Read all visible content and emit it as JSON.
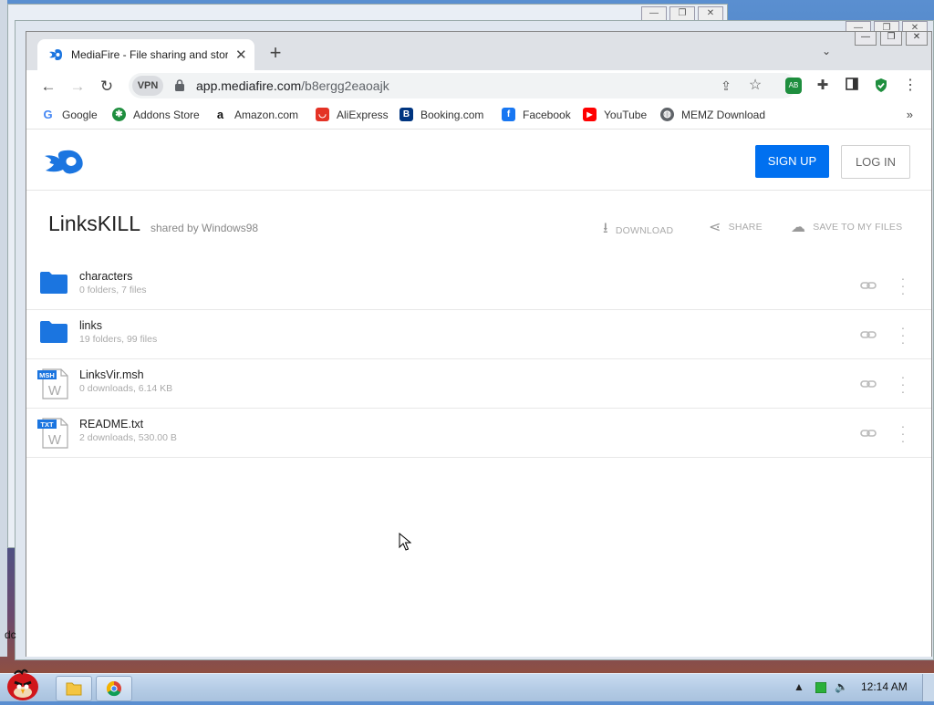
{
  "browser": {
    "tab_title": "MediaFire - File sharing and storage",
    "new_tab_label": "+",
    "vpn_label": "VPN",
    "url_host": "app.mediafire.com",
    "url_path": "/b8ergg2eaoajk",
    "window_controls": [
      "—",
      "❐",
      "✕"
    ]
  },
  "bookmarks": [
    {
      "label": "Google",
      "icon": "google-icon",
      "color": "#ffffff"
    },
    {
      "label": "Addons Store",
      "icon": "addons-store-icon",
      "color": "#1e8e3e"
    },
    {
      "label": "Amazon.com",
      "icon": "amazon-icon",
      "color": "#ffffff"
    },
    {
      "label": "AliExpress",
      "icon": "aliexpress-icon",
      "color": "#e43225"
    },
    {
      "label": "Booking.com",
      "icon": "booking-icon",
      "color": "#003580"
    },
    {
      "label": "Facebook",
      "icon": "facebook-icon",
      "color": "#1877f2"
    },
    {
      "label": "YouTube",
      "icon": "youtube-icon",
      "color": "#ff0000"
    },
    {
      "label": "MEMZ Download",
      "icon": "globe-icon",
      "color": "#5f6368"
    }
  ],
  "mediafire": {
    "signup_label": "SIGN UP",
    "login_label": "LOG IN",
    "brand_color": "#0070f0",
    "folder_name": "LinksKILL",
    "shared_by": "shared by Windows98",
    "actions": {
      "download": "DOWNLOAD",
      "share": "SHARE",
      "save": "SAVE TO MY FILES"
    },
    "items": [
      {
        "name": "characters",
        "meta": "0 folders, 7 files",
        "type": "folder"
      },
      {
        "name": "links",
        "meta": "19 folders, 99 files",
        "type": "folder"
      },
      {
        "name": "LinksVir.msh",
        "meta": "0 downloads, 6.14 KB",
        "type": "file",
        "badge": "MSH"
      },
      {
        "name": "README.txt",
        "meta": "2 downloads, 530.00 B",
        "type": "file",
        "badge": "TXT"
      }
    ]
  },
  "desktop": {
    "partial_label": "dc"
  },
  "taskbar": {
    "clock": "12:14 AM"
  }
}
